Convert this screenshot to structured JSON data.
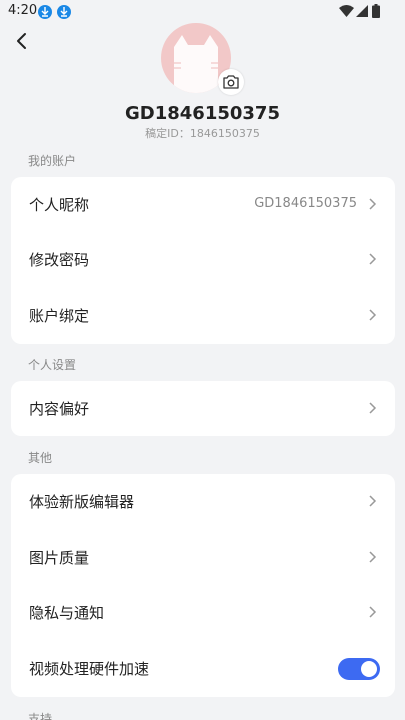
{
  "status_bar": {
    "time": "4:20"
  },
  "profile": {
    "name": "GD1846150375",
    "id_text": "稿定ID：1846150375"
  },
  "sections": {
    "account": {
      "title": "我的账户",
      "items": [
        {
          "label": "个人昵称",
          "value": "GD1846150375"
        },
        {
          "label": "修改密码"
        },
        {
          "label": "账户绑定"
        }
      ]
    },
    "personal": {
      "title": "个人设置",
      "items": [
        {
          "label": "内容偏好"
        }
      ]
    },
    "other": {
      "title": "其他",
      "items": [
        {
          "label": "体验新版编辑器"
        },
        {
          "label": "图片质量"
        },
        {
          "label": "隐私与通知"
        },
        {
          "label": "视频处理硬件加速",
          "toggle_on": true
        }
      ]
    },
    "support": {
      "title": "支持"
    }
  },
  "colors": {
    "accent": "#3d6af2",
    "avatar_bg": "#f2c8c8",
    "background": "#f2f3f5"
  },
  "icons": [
    "back-arrow-icon",
    "camera-icon",
    "chevron-right-icon",
    "wifi-icon",
    "signal-icon",
    "battery-icon"
  ]
}
